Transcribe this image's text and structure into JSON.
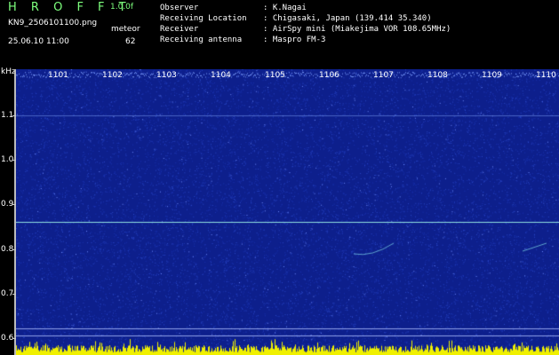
{
  "header": {
    "app_title": "H R O F F T",
    "version": "1.0.0f",
    "filename": "KN9_2506101100.png",
    "meteor_label": "meteor",
    "datetime": "25.06.10 11:00",
    "meteor_count": "62",
    "info": [
      {
        "key": "Observer",
        "value": ": K.Nagai"
      },
      {
        "key": "Receiving Location",
        "value": ": Chigasaki, Japan (139.414 35.340)"
      },
      {
        "key": "Receiver",
        "value": ": AirSpy mini (Miakejima VOR 108.65MHz)"
      },
      {
        "key": "Receiving antenna",
        "value": ": Maspro FM-3"
      }
    ]
  },
  "chart_data": {
    "type": "heatmap",
    "ylabel": "kHz",
    "y_ticks": [
      "1.1",
      "1.0",
      "0.9",
      "0.8",
      "0.7",
      "0.6"
    ],
    "minute_labels": [
      "1101",
      "1102",
      "1103",
      "1104",
      "1105",
      "1106",
      "1107",
      "1108",
      "1109",
      "1110"
    ],
    "colors": {
      "background": "#0d1f8c",
      "noise": "#2f4fd0",
      "signal": "#9ff4e8",
      "bottom_bars": "#f0f000"
    }
  }
}
